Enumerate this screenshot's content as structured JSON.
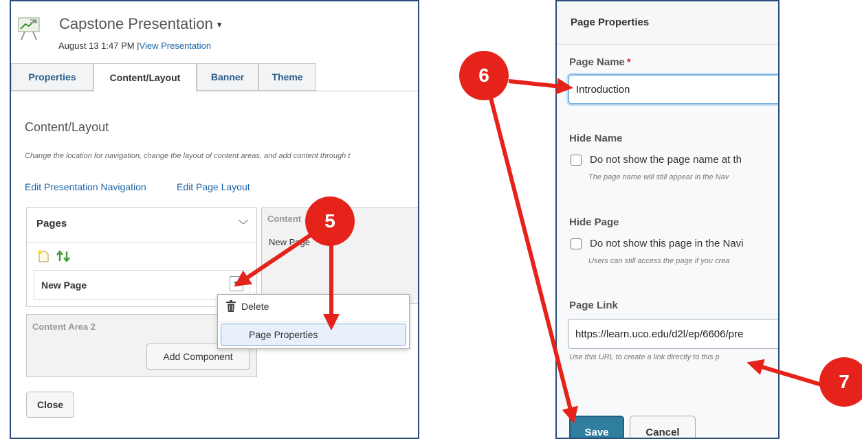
{
  "left": {
    "title": "Capstone Presentation",
    "title_caret": "▾",
    "subtitle_date": "August 13 1:47 PM |",
    "subtitle_link": "View Presentation",
    "tabs": [
      {
        "label": "Properties"
      },
      {
        "label": "Content/Layout"
      },
      {
        "label": "Banner"
      },
      {
        "label": "Theme"
      }
    ],
    "section_title": "Content/Layout",
    "section_desc": "Change the location for navigation, change the layout of content areas, and add content through t",
    "links": {
      "nav": "Edit Presentation Navigation",
      "layout": "Edit Page Layout"
    },
    "pages_header": "Pages",
    "page_item": "New Page",
    "content_box_label": "Content",
    "content_box_sub": "New Page",
    "content_area2": "Content Area 2",
    "add_component": "Add Component",
    "close": "Close",
    "menu": {
      "delete": "Delete",
      "page_properties": "Page Properties"
    }
  },
  "right": {
    "header": "Page Properties",
    "page_name_label": "Page Name",
    "required_mark": "*",
    "page_name_value": "Introduction",
    "hide_name_label": "Hide Name",
    "hide_name_option": "Do not show the page name at th",
    "hide_name_help": "The page name will still appear in the Nav",
    "hide_page_label": "Hide Page",
    "hide_page_option": "Do not show this page in the Navi",
    "hide_page_help": "Users can still access the page if you crea",
    "page_link_label": "Page Link",
    "page_link_value": "https://learn.uco.edu/d2l/ep/6606/pre",
    "page_link_help": "Use this URL to create a link directly to this p",
    "save": "Save",
    "cancel": "Cancel"
  },
  "annotations": {
    "step5": "5",
    "step6": "6",
    "step7": "7",
    "color": "#e5231b"
  },
  "colors": {
    "panel_border": "#2a4d7a",
    "link": "#1a63a8",
    "tab_text": "#2a5c87",
    "save_button": "#2f7ea0"
  }
}
